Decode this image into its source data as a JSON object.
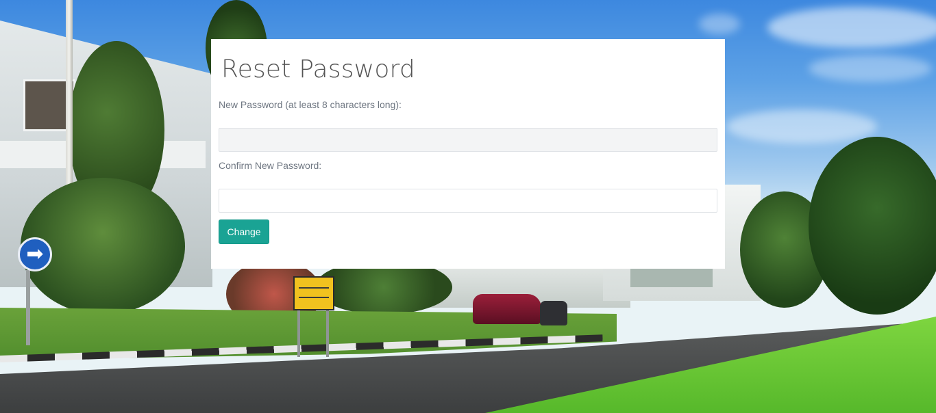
{
  "page": {
    "title": "Reset Password"
  },
  "form": {
    "new_password_label": "New Password (at least 8 characters long):",
    "new_password_value": "",
    "confirm_password_label": "Confirm New Password:",
    "confirm_password_value": "",
    "submit_label": "Change"
  },
  "colors": {
    "accent": "#1aa394",
    "card_background": "#ffffff",
    "label_text": "#6f7782",
    "title_text": "#545454"
  },
  "icons": {
    "background_sign": "arrow-right-icon"
  }
}
